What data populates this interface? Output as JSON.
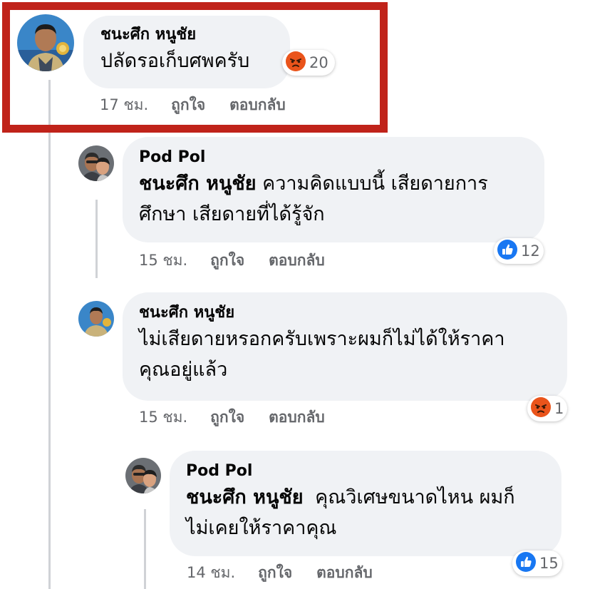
{
  "comments": [
    {
      "author": "ชนะศึก หนูชัย",
      "text": "ปลัดรอเก็บศพครับ",
      "time": "17 ชม.",
      "like_label": "ถูกใจ",
      "reply_label": "ตอบกลับ",
      "reaction": {
        "icon": "angry-icon",
        "count": "20",
        "color": "#f26b1d"
      },
      "highlighted": true
    },
    {
      "author": "Pod Pol",
      "mention": "ชนะศึก หนูชัย",
      "text_line1": "ความคิดแบบนี้ เสียดายการ",
      "text_line2": "ศึกษา เสียดายที่ได้รู้จัก",
      "time": "15 ชม.",
      "like_label": "ถูกใจ",
      "reply_label": "ตอบกลับ",
      "reaction": {
        "icon": "like-icon",
        "count": "12",
        "color": "#1877f2"
      }
    },
    {
      "author": "ชนะศึก หนูชัย",
      "text_line1": "ไม่เสียดายหรอกครับเพราะผมก็ไม่ได้ให้ราคา",
      "text_line2": "คุณอยู่แล้ว",
      "time": "15 ชม.",
      "like_label": "ถูกใจ",
      "reply_label": "ตอบกลับ",
      "reaction": {
        "icon": "angry-icon",
        "count": "1",
        "color": "#f26b1d"
      }
    },
    {
      "author": "Pod Pol",
      "mention": "ชนะศึก หนูชัย",
      "text_line1": "คุณวิเศษขนาดไหน ผมก็",
      "text_line2": "ไม่เคยให้ราคาคุณ",
      "time": "14 ชม.",
      "like_label": "ถูกใจ",
      "reply_label": "ตอบกลับ",
      "reaction": {
        "icon": "like-icon",
        "count": "15",
        "color": "#1877f2"
      }
    }
  ]
}
